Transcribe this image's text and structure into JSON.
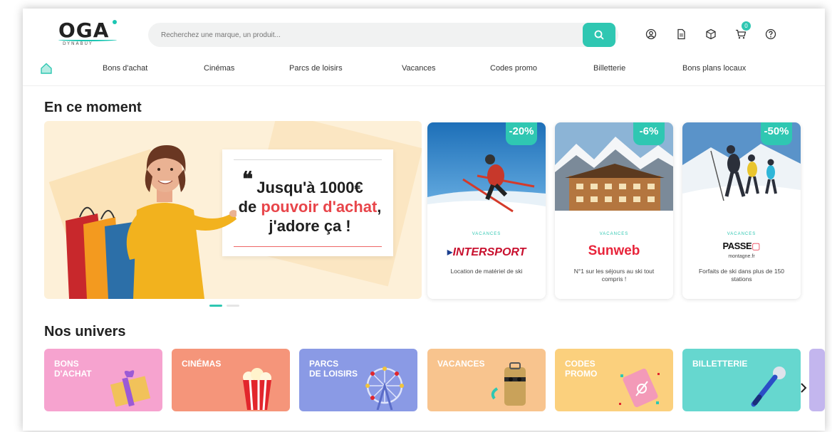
{
  "header": {
    "logo_text": "OGA",
    "logo_sub": "DYNABUY",
    "search_placeholder": "Recherchez une marque, un produit...",
    "cart_count": "0",
    "icons": [
      "user-icon",
      "document-icon",
      "package-icon",
      "cart-icon",
      "help-icon"
    ]
  },
  "nav": {
    "items": [
      "Bons d'achat",
      "Cinémas",
      "Parcs de loisirs",
      "Vacances",
      "Codes promo",
      "Billetterie",
      "Bons plans locaux"
    ]
  },
  "sections": {
    "now_title": "En ce moment",
    "universes_title": "Nos univers"
  },
  "hero": {
    "quote_mark": "❝",
    "line1": "Jusqu'à 1000€",
    "line2_prefix": "de ",
    "line2_red": "pouvoir d'achat",
    "line2_suffix": ",",
    "line3": "j'adore ça !"
  },
  "deals": [
    {
      "badge": "-20%",
      "category": "VACANCES",
      "brand": "INTERSPORT",
      "brand_color": "#c8102e",
      "description": "Location de matériel de ski"
    },
    {
      "badge": "-6%",
      "category": "VACANCES",
      "brand": "Sunweb",
      "brand_color": "#e8253b",
      "description": "N°1 sur les séjours au ski tout compris !"
    },
    {
      "badge": "-50%",
      "category": "VACANCES",
      "brand": "PASSE",
      "brand_sub": "montagne.fr",
      "brand_color": "#111111",
      "description": "Forfaits de ski dans plus de 150 stations"
    }
  ],
  "universes": [
    {
      "label": "BONS\nD'ACHAT",
      "color": "#f6a3cf"
    },
    {
      "label": "CINÉMAS",
      "color": "#f5957a"
    },
    {
      "label": "PARCS\nDE LOISIRS",
      "color": "#8a9ae5"
    },
    {
      "label": "VACANCES",
      "color": "#f8c48e"
    },
    {
      "label": "CODES\nPROMO",
      "color": "#fbd07d"
    },
    {
      "label": "BILLETTERIE",
      "color": "#66d7cf"
    }
  ],
  "colors": {
    "accent": "#2fc7b2",
    "hero_red": "#e8454a"
  }
}
